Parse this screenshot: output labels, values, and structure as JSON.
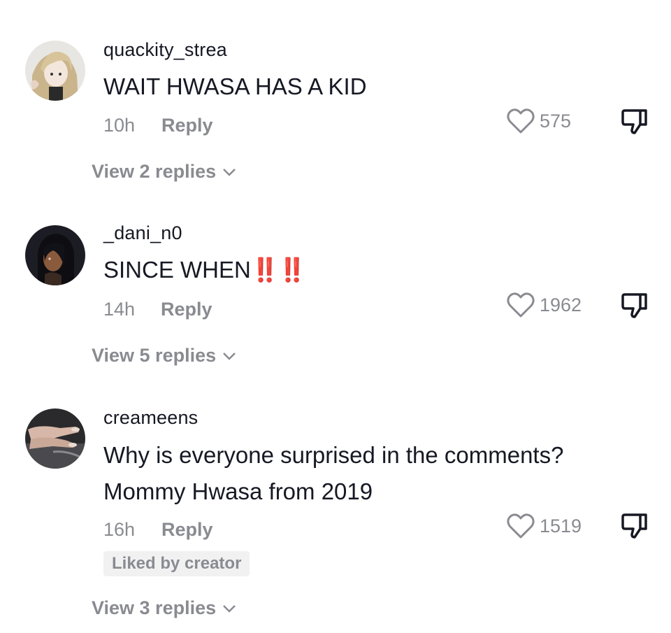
{
  "comments": [
    {
      "username": "quackity_strea",
      "text": "WAIT HWASA HAS A KID",
      "time": "10h",
      "reply_label": "Reply",
      "likes": "575",
      "view_replies": "View 2 replies",
      "avatar_icon": "anime-girl-avatar"
    },
    {
      "username": "_dani_n0",
      "text": "SINCE WHEN",
      "emoji": "‼️‼️",
      "time": "14h",
      "reply_label": "Reply",
      "likes": "1962",
      "view_replies": "View 5 replies",
      "avatar_icon": "dark-anime-avatar"
    },
    {
      "username": "creameens",
      "text_line1": "Why is everyone surprised in the comments?",
      "text_line2": "Mommy Hwasa from 2019",
      "time": "16h",
      "reply_label": "Reply",
      "likes": "1519",
      "badge": "Liked by creator",
      "view_replies": "View 3 replies",
      "avatar_icon": "hand-nails-avatar"
    }
  ],
  "colors": {
    "text_primary": "#161823",
    "text_secondary": "#8a8b91",
    "accent_red": "#e01a1a",
    "badge_bg": "#f1f1f2"
  }
}
